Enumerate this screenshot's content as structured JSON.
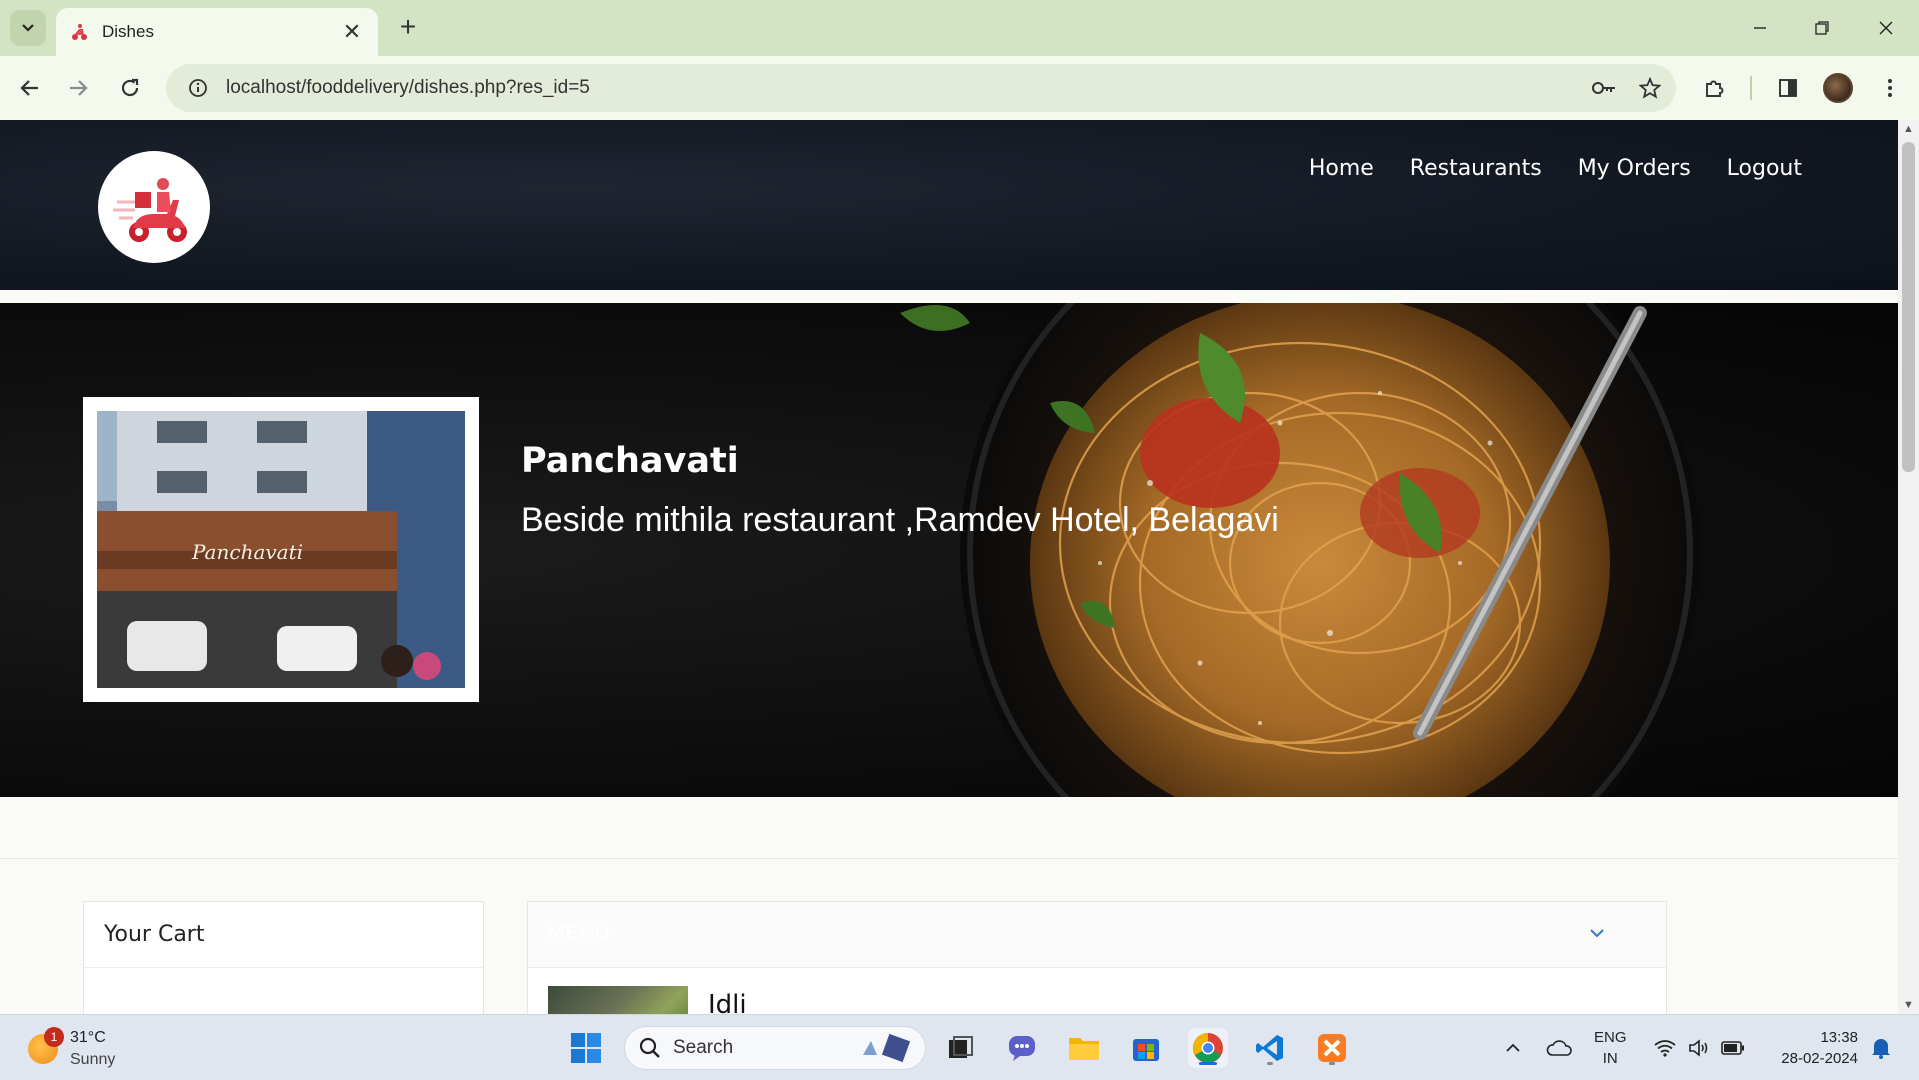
{
  "browser": {
    "tab_title": "Dishes",
    "url": "localhost/fooddelivery/dishes.php?res_id=5"
  },
  "site": {
    "nav": [
      "Home",
      "Restaurants",
      "My Orders",
      "Logout"
    ]
  },
  "restaurant": {
    "name": "Panchavati",
    "address": "Beside mithila restaurant ,Ramdev Hotel, Belagavi",
    "sign_text": "Panchavati"
  },
  "cart": {
    "title": "Your Cart"
  },
  "menu": {
    "title": "MENU",
    "first_dish": "Idli"
  },
  "taskbar": {
    "weather_temp": "31°C",
    "weather_cond": "Sunny",
    "weather_badge": "1",
    "search_label": "Search",
    "lang_line1": "ENG",
    "lang_line2": "IN",
    "time": "13:38",
    "date": "28-02-2024"
  },
  "colors": {
    "header_bg": "#121822",
    "hero_bg": "#0d0d0d",
    "chrome_tab_bg": "#d3e3c4",
    "chrome_toolbar_bg": "#f4f9ee"
  }
}
